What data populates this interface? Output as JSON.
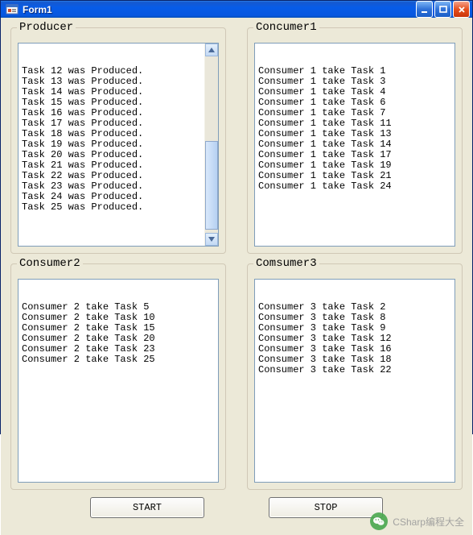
{
  "window": {
    "title": "Form1"
  },
  "groups": {
    "producer": {
      "title": "Producer",
      "lines": [
        "Task 12 was Produced.",
        "Task 13 was Produced.",
        "Task 14 was Produced.",
        "Task 15 was Produced.",
        "Task 16 was Produced.",
        "Task 17 was Produced.",
        "Task 18 was Produced.",
        "Task 19 was Produced.",
        "Task 20 was Produced.",
        "Task 21 was Produced.",
        "Task 22 was Produced.",
        "Task 23 was Produced.",
        "Task 24 was Produced.",
        "Task 25 was Produced."
      ]
    },
    "consumer1": {
      "title": "Concumer1",
      "lines": [
        "Consumer 1 take Task 1",
        "Consumer 1 take Task 3",
        "Consumer 1 take Task 4",
        "Consumer 1 take Task 6",
        "Consumer 1 take Task 7",
        "Consumer 1 take Task 11",
        "Consumer 1 take Task 13",
        "Consumer 1 take Task 14",
        "Consumer 1 take Task 17",
        "Consumer 1 take Task 19",
        "Consumer 1 take Task 21",
        "Consumer 1 take Task 24"
      ]
    },
    "consumer2": {
      "title": "Consumer2",
      "lines": [
        "Consumer 2 take Task 5",
        "Consumer 2 take Task 10",
        "Consumer 2 take Task 15",
        "Consumer 2 take Task 20",
        "Consumer 2 take Task 23",
        "Consumer 2 take Task 25"
      ]
    },
    "consumer3": {
      "title": "Comsumer3",
      "lines": [
        "Consumer 3 take Task 2",
        "Consumer 3 take Task 8",
        "Consumer 3 take Task 9",
        "Consumer 3 take Task 12",
        "Consumer 3 take Task 16",
        "Consumer 3 take Task 18",
        "Consumer 3 take Task 22"
      ]
    }
  },
  "buttons": {
    "start": "START",
    "stop": "STOP"
  },
  "watermark": "CSharp编程大全"
}
